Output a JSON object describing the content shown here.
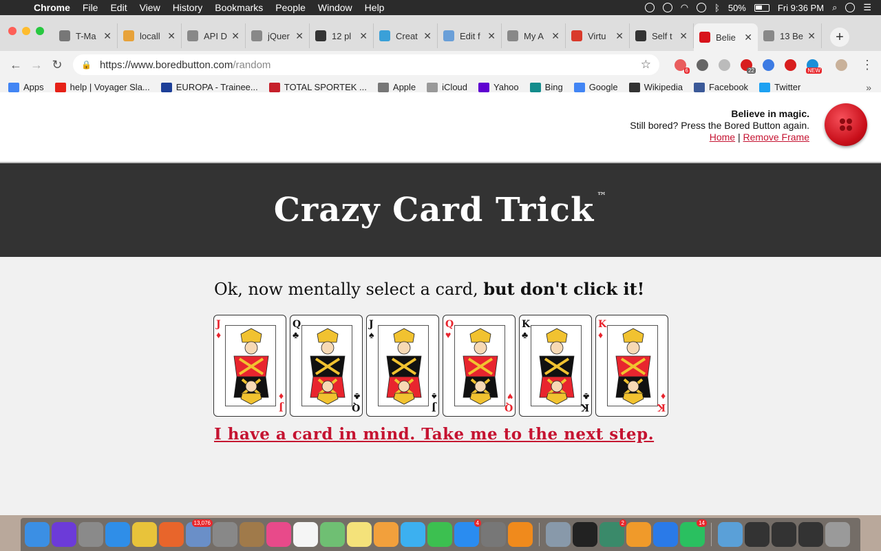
{
  "menubar": {
    "app": "Chrome",
    "items": [
      "File",
      "Edit",
      "View",
      "History",
      "Bookmarks",
      "People",
      "Window",
      "Help"
    ],
    "battery": "50%",
    "clock": "Fri 9:36 PM"
  },
  "tabs": [
    {
      "label": "T-Ma",
      "color": "#777777"
    },
    {
      "label": "locall",
      "color": "#e7a23a"
    },
    {
      "label": "API D",
      "color": "#888888"
    },
    {
      "label": "jQuer",
      "color": "#888888"
    },
    {
      "label": "12 pl",
      "color": "#333333"
    },
    {
      "label": "Creat",
      "color": "#3aa0d8"
    },
    {
      "label": "Edit f",
      "color": "#6a9fd8"
    },
    {
      "label": "My A",
      "color": "#888888"
    },
    {
      "label": "Virtu",
      "color": "#d93a2b"
    },
    {
      "label": "Self t",
      "color": "#333333"
    },
    {
      "label": "Belie",
      "color": "#d8141c",
      "active": true
    },
    {
      "label": "13 Be",
      "color": "#888888"
    }
  ],
  "address": {
    "host": "https://www.boredbutton.com",
    "path": "/random"
  },
  "extensions": [
    {
      "color": "#e95d5d",
      "badge": "6",
      "badge_color": "#e8262b"
    },
    {
      "color": "#666666",
      "badge": "",
      "badge_color": ""
    },
    {
      "color": "#bbbbbb",
      "badge": "",
      "badge_color": ""
    },
    {
      "color": "#d81e1e",
      "badge": "22",
      "badge_color": "#666666"
    },
    {
      "color": "#3d7be3",
      "badge": "",
      "badge_color": ""
    },
    {
      "color": "#d81e1e",
      "badge": "",
      "badge_color": ""
    },
    {
      "color": "#1a8fd8",
      "badge": "NEW",
      "badge_color": "#e8262b"
    }
  ],
  "bookmarks": [
    {
      "label": "Apps",
      "icon": "apps-grid-icon",
      "color": "#4285f4"
    },
    {
      "label": "help | Voyager Sla...",
      "icon": "youtube-icon",
      "color": "#e62117"
    },
    {
      "label": "EUROPA - Trainee...",
      "icon": "eu-flag-icon",
      "color": "#1d3f98"
    },
    {
      "label": "TOTAL SPORTEK ...",
      "icon": "ts-logo-icon",
      "color": "#c6202b"
    },
    {
      "label": "Apple",
      "icon": "apple-icon",
      "color": "#777777"
    },
    {
      "label": "iCloud",
      "icon": "page-icon",
      "color": "#999999"
    },
    {
      "label": "Yahoo",
      "icon": "yahoo-icon",
      "color": "#5f01d1"
    },
    {
      "label": "Bing",
      "icon": "bing-icon",
      "color": "#138c8c"
    },
    {
      "label": "Google",
      "icon": "google-icon",
      "color": "#4285f4"
    },
    {
      "label": "Wikipedia",
      "icon": "wikipedia-icon",
      "color": "#333333"
    },
    {
      "label": "Facebook",
      "icon": "facebook-icon",
      "color": "#3b5998"
    },
    {
      "label": "Twitter",
      "icon": "twitter-icon",
      "color": "#1da1f2"
    }
  ],
  "site": {
    "tagline": "Believe in magic.",
    "subline": "Still bored? Press the Bored Button again.",
    "home_link": "Home",
    "separator": "|",
    "remove_frame_link": "Remove Frame",
    "title": "Crazy Card Trick",
    "trademark": "™",
    "prompt_plain": "Ok, now mentally select a card, ",
    "prompt_bold": "but don't click it",
    "prompt_end": "!",
    "next_link": "I have a card in mind. Take me to the next step."
  },
  "cards": [
    {
      "rank": "J",
      "suit": "♦",
      "color": "red"
    },
    {
      "rank": "Q",
      "suit": "♣",
      "color": "black"
    },
    {
      "rank": "J",
      "suit": "♠",
      "color": "black"
    },
    {
      "rank": "Q",
      "suit": "♥",
      "color": "red"
    },
    {
      "rank": "K",
      "suit": "♣",
      "color": "black"
    },
    {
      "rank": "K",
      "suit": "♦",
      "color": "red"
    }
  ],
  "dock": [
    {
      "name": "finder",
      "color": "#3b8fe4",
      "badge": ""
    },
    {
      "name": "siri",
      "color": "#6c3bd8",
      "badge": ""
    },
    {
      "name": "launchpad",
      "color": "#8a8a8a",
      "badge": ""
    },
    {
      "name": "safari",
      "color": "#2f8ee8",
      "badge": ""
    },
    {
      "name": "chrome",
      "color": "#e8c33a",
      "badge": ""
    },
    {
      "name": "firefox",
      "color": "#e8652b",
      "badge": ""
    },
    {
      "name": "mail-preview",
      "color": "#6a8fc8",
      "badge": "13,076"
    },
    {
      "name": "calculator",
      "color": "#888888",
      "badge": ""
    },
    {
      "name": "notes-brown",
      "color": "#a07a4a",
      "badge": ""
    },
    {
      "name": "itunes",
      "color": "#e84a8a",
      "badge": ""
    },
    {
      "name": "calendar",
      "color": "#f5f5f5",
      "badge": ""
    },
    {
      "name": "maps",
      "color": "#6fbf73",
      "badge": ""
    },
    {
      "name": "notes",
      "color": "#f4e27a",
      "badge": ""
    },
    {
      "name": "photos",
      "color": "#f2a03c",
      "badge": ""
    },
    {
      "name": "messages",
      "color": "#3cb0f0",
      "badge": ""
    },
    {
      "name": "facetime",
      "color": "#3cc050",
      "badge": ""
    },
    {
      "name": "app-store",
      "color": "#2a8cf0",
      "badge": "4"
    },
    {
      "name": "system-preferences",
      "color": "#777777",
      "badge": ""
    },
    {
      "name": "vlc",
      "color": "#f08a1c",
      "badge": ""
    },
    {
      "name": "sep",
      "color": "",
      "badge": ""
    },
    {
      "name": "utility",
      "color": "#8899aa",
      "badge": ""
    },
    {
      "name": "terminal",
      "color": "#222222",
      "badge": ""
    },
    {
      "name": "slack",
      "color": "#3a8a6a",
      "badge": "2"
    },
    {
      "name": "sublime",
      "color": "#f09a2a",
      "badge": ""
    },
    {
      "name": "maps-pin",
      "color": "#2a7ae8",
      "badge": ""
    },
    {
      "name": "whatsapp",
      "color": "#2ac060",
      "badge": "14"
    },
    {
      "name": "sep",
      "color": "",
      "badge": ""
    },
    {
      "name": "folder",
      "color": "#5aa0d8",
      "badge": ""
    },
    {
      "name": "window-1",
      "color": "#333333",
      "badge": ""
    },
    {
      "name": "window-2",
      "color": "#333333",
      "badge": ""
    },
    {
      "name": "window-3",
      "color": "#333333",
      "badge": ""
    },
    {
      "name": "trash",
      "color": "#9a9a9a",
      "badge": ""
    }
  ]
}
